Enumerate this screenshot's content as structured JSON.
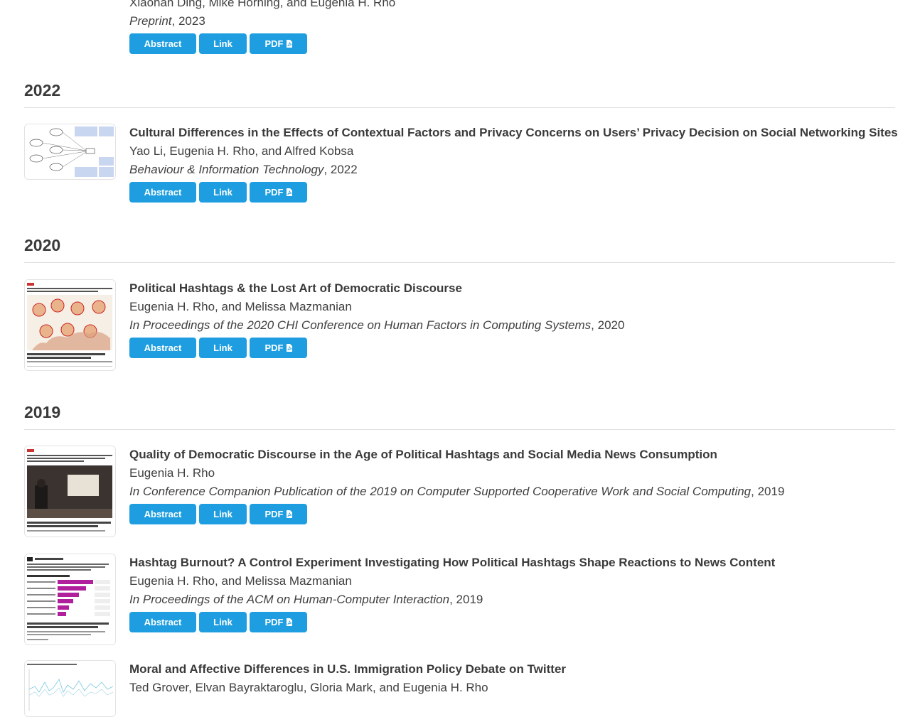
{
  "buttons": {
    "abstract": "Abstract",
    "link": "Link",
    "pdf": "PDF"
  },
  "top_entry": {
    "authors_partial": "Xiaohan Ding, Mike Horning, and Eugenia H. Rho",
    "venue": "Preprint",
    "year": ", 2023"
  },
  "years": [
    "2022",
    "2020",
    "2019"
  ],
  "pubs": [
    {
      "title": "Cultural Differences in the Effects of Contextual Factors and Privacy Concerns on Users’ Privacy Decision on Social Networking Sites",
      "authors": "Yao Li, Eugenia H. Rho, and Alfred Kobsa",
      "venue": "Behaviour & Information Technology",
      "year": ", 2022"
    },
    {
      "title": "Political Hashtags & the Lost Art of Democratic Discourse",
      "authors": "Eugenia H. Rho, and Melissa Mazmanian",
      "venue": "In Proceedings of the 2020 CHI Conference on Human Factors in Computing Systems",
      "year": ", 2020"
    },
    {
      "title": "Quality of Democratic Discourse in the Age of Political Hashtags and Social Media News Consumption",
      "authors": "Eugenia H. Rho",
      "venue": "In Conference Companion Publication of the 2019 on Computer Supported Cooperative Work and Social Computing",
      "year": ", 2019"
    },
    {
      "title": "Hashtag Burnout? A Control Experiment Investigating How Political Hashtags Shape Reactions to News Content",
      "authors": "Eugenia H. Rho, and Melissa Mazmanian",
      "venue": "In Proceedings of the ACM on Human-Computer Interaction",
      "year": ", 2019"
    },
    {
      "title": "Moral and Affective Differences in U.S. Immigration Policy Debate on Twitter",
      "authors": "Ted Grover, Elvan Bayraktaroglu, Gloria Mark, and Eugenia H. Rho"
    }
  ],
  "colors": {
    "button": "#1e9ee0",
    "text": "#404040",
    "divider": "#dedede"
  },
  "icons": {
    "pdf": "file-pdf-icon"
  }
}
